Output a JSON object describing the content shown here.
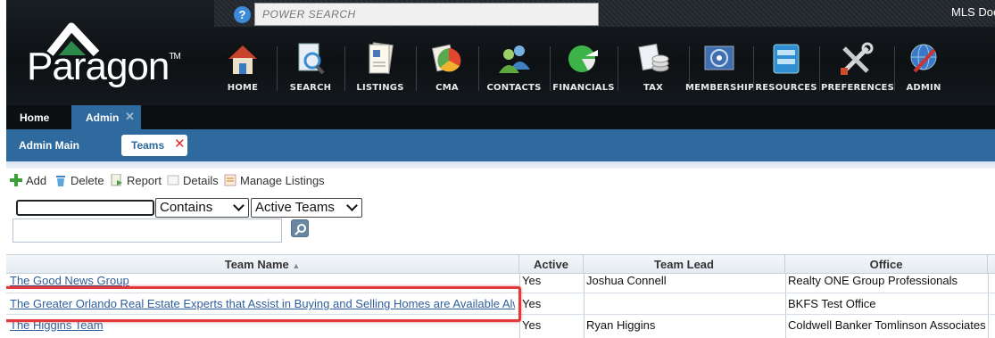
{
  "header": {
    "logo_text": "Paragon",
    "logo_tm": "TM",
    "help_icon": "?",
    "power_search_placeholder": "POWER SEARCH",
    "mls_doc": "MLS Doc"
  },
  "nav": [
    {
      "label": "HOME",
      "icon": "house-icon"
    },
    {
      "label": "SEARCH",
      "icon": "search-document-icon"
    },
    {
      "label": "LISTINGS",
      "icon": "listings-icon"
    },
    {
      "label": "CMA",
      "icon": "cma-icon"
    },
    {
      "label": "CONTACTS",
      "icon": "contacts-icon"
    },
    {
      "label": "FINANCIALS",
      "icon": "pie-chart-icon"
    },
    {
      "label": "TAX",
      "icon": "tax-icon"
    },
    {
      "label": "MEMBERSHIP",
      "icon": "membership-icon"
    },
    {
      "label": "RESOURCES",
      "icon": "resources-icon"
    },
    {
      "label": "PREFERENCES",
      "icon": "tools-icon"
    },
    {
      "label": "ADMIN",
      "icon": "admin-globe-icon"
    }
  ],
  "tabs": {
    "home": "Home",
    "admin": "Admin",
    "close": "✕"
  },
  "subtabs": {
    "admin_main": "Admin Main",
    "teams": "Teams",
    "teams_close": "✕"
  },
  "toolbar": {
    "add": "Add",
    "delete": "Delete",
    "report": "Report",
    "details": "Details",
    "manage_listings": "Manage Listings"
  },
  "filter": {
    "text_value": "",
    "operator": "Contains",
    "scope": "Active Teams",
    "search_value": ""
  },
  "table": {
    "columns": [
      "Team Name",
      "Active",
      "Team Lead",
      "Office"
    ],
    "sort_indicator": "▲",
    "rows": [
      {
        "name": "The Good News Group",
        "active": "Yes",
        "lead": "Joshua Connell",
        "office": "Realty ONE Group Professionals"
      },
      {
        "name": "The Greater Orlando Real Estate Experts that Assist in Buying and Selling Homes are Available Always",
        "active": "Yes",
        "lead": "",
        "office": "BKFS Test Office"
      },
      {
        "name": "The Higgins Team",
        "active": "Yes",
        "lead": "Ryan Higgins",
        "office": "Coldwell Banker Tomlinson Associates - Le"
      }
    ]
  },
  "colors": {
    "accent_blue": "#2e6a9e",
    "highlight_red": "#e23a3a",
    "link": "#2f5f9a"
  }
}
